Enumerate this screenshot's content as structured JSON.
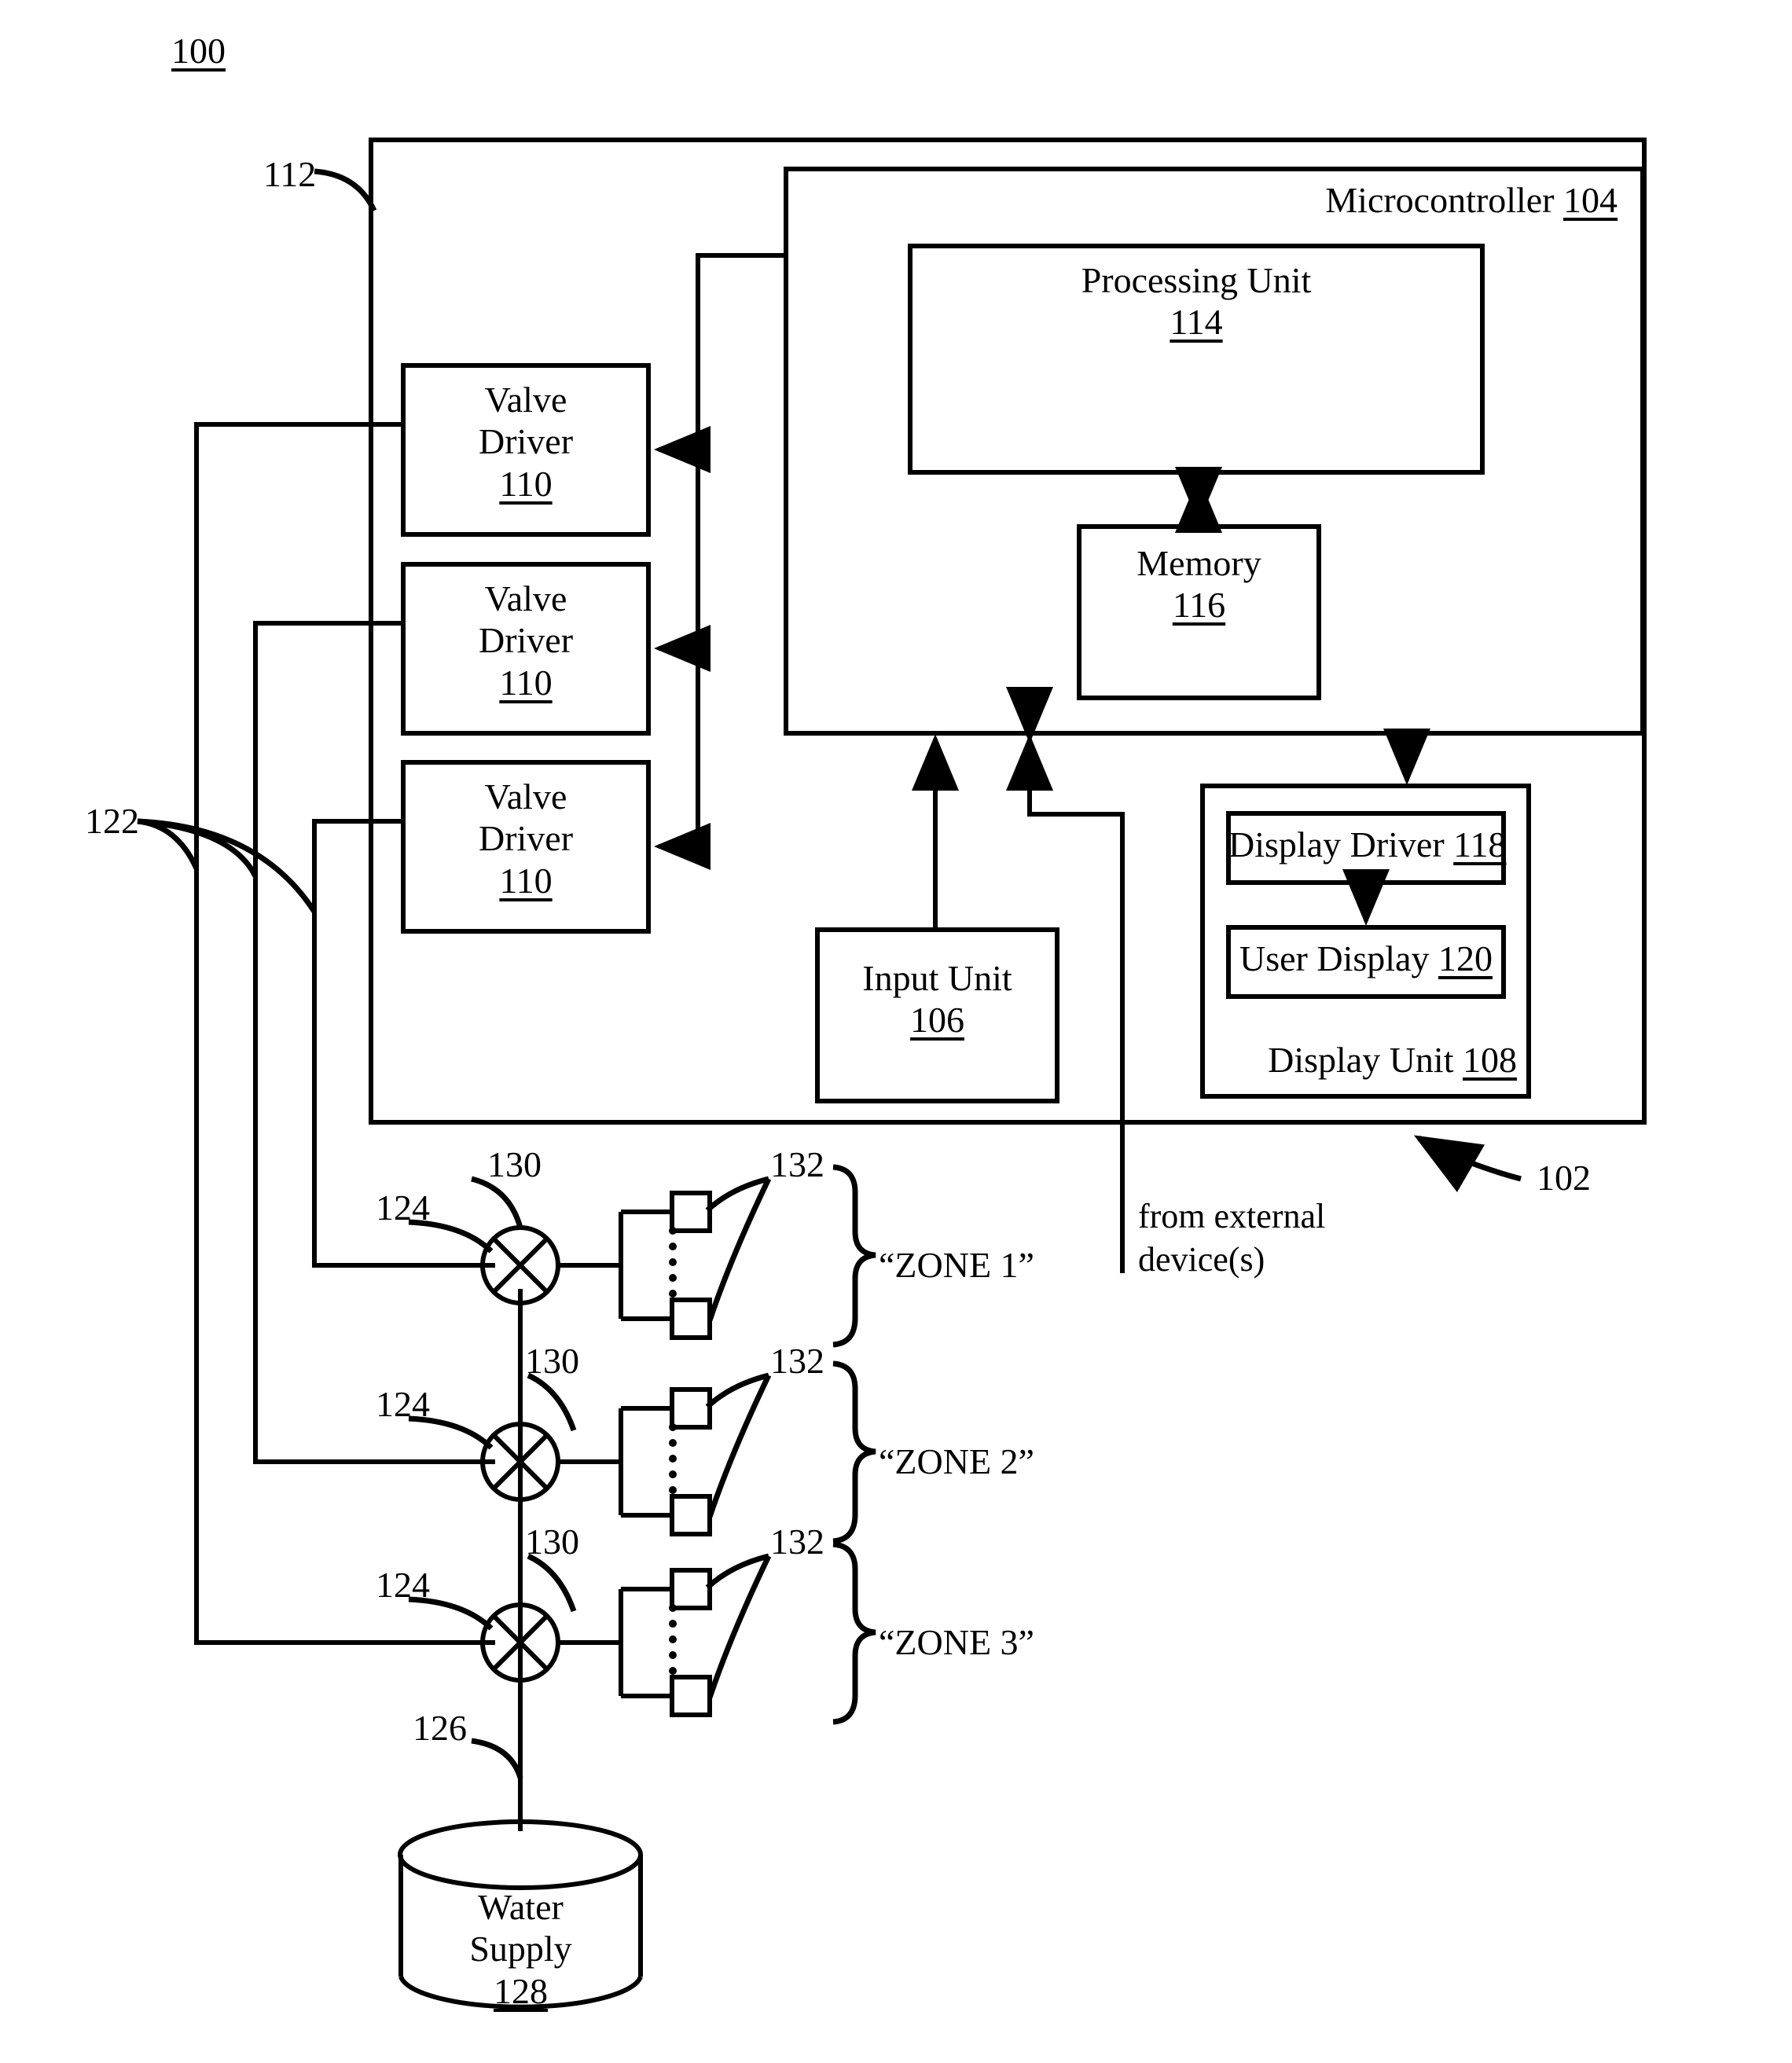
{
  "figure": {
    "number": "100"
  },
  "system": {
    "enclosure_ref": "112",
    "controller_assembly_ref": "102",
    "wiring_ref": "122",
    "external_note_line1": "from external",
    "external_note_line2": "device(s)"
  },
  "microcontroller": {
    "title": "Microcontroller",
    "ref": "104",
    "processing_unit": {
      "title": "Processing Unit",
      "ref": "114"
    },
    "memory": {
      "title": "Memory",
      "ref": "116"
    }
  },
  "input_unit": {
    "title": "Input Unit",
    "ref": "106"
  },
  "display_unit": {
    "title": "Display Unit",
    "ref": "108",
    "display_driver": {
      "title": "Display Driver",
      "ref": "118"
    },
    "user_display": {
      "title": "User Display",
      "ref": "120"
    }
  },
  "valve_drivers": [
    {
      "line1": "Valve",
      "line2": "Driver",
      "ref": "110"
    },
    {
      "line1": "Valve",
      "line2": "Driver",
      "ref": "110"
    },
    {
      "line1": "Valve",
      "line2": "Driver",
      "ref": "110"
    }
  ],
  "zones": [
    {
      "label": "“ZONE 1”",
      "valve_ref": "124",
      "pipe_ref": "130",
      "sprinkler_ref": "132"
    },
    {
      "label": "“ZONE 2”",
      "valve_ref": "124",
      "pipe_ref": "130",
      "sprinkler_ref": "132"
    },
    {
      "label": "“ZONE 3”",
      "valve_ref": "124",
      "pipe_ref": "130",
      "sprinkler_ref": "132"
    }
  ],
  "main_line": {
    "ref": "126"
  },
  "water_supply": {
    "line1": "Water",
    "line2": "Supply",
    "ref": "128"
  }
}
